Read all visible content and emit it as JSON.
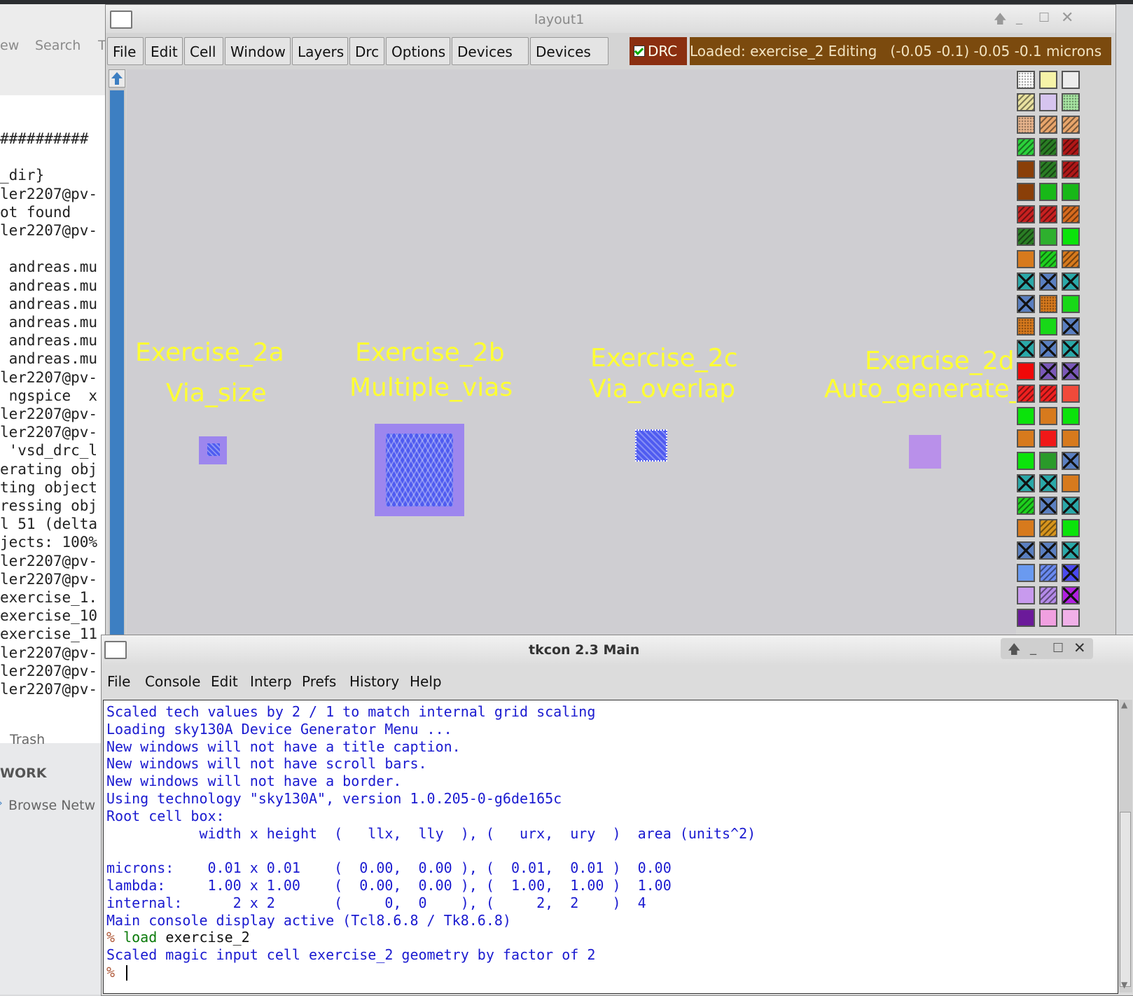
{
  "background_app": {
    "toolbar": {
      "menu_left": "ew",
      "search": "Search",
      "menu_right": "T"
    },
    "terminal_lines": [
      "##########",
      "",
      "_dir}",
      "ler2207@pv-",
      "ot found",
      "ler2207@pv-",
      "",
      " andreas.mu",
      " andreas.mu",
      " andreas.mu",
      " andreas.mu",
      " andreas.mu",
      " andreas.mu",
      "ler2207@pv-",
      " ngspice  x",
      "ler2207@pv-",
      "ler2207@pv-",
      " 'vsd_drc_l",
      "erating obj",
      "ting object",
      "ressing obj",
      "l 51 (delta",
      "jects: 100%",
      "ler2207@pv-",
      "ler2207@pv-",
      "exercise_1.",
      "exercise_10",
      "exercise_11",
      "ler2207@pv-",
      "ler2207@pv-",
      "ler2207@pv-"
    ],
    "sidebar": {
      "trash": "Trash",
      "network_header": "WORK",
      "browse": "Browse Netw"
    }
  },
  "layout_window": {
    "title": "layout1",
    "menu": [
      "File",
      "Edit",
      "Cell",
      "Window",
      "Layers",
      "Drc",
      "Options",
      "Devices 1",
      "Devices 2"
    ],
    "drc_label": "DRC",
    "status": "Loaded: exercise_2 Editing   (-0.05 -0.1) -0.05 -0.1 microns",
    "labels": {
      "ex2a_title": "Exercise_2a",
      "ex2a_sub": "Via_size",
      "ex2b_title": "Exercise_2b",
      "ex2b_sub": "Multiple_vias",
      "ex2c_title": "Exercise_2c",
      "ex2c_sub": "Via_overlap",
      "ex2d_title": "Exercise_2d",
      "ex2d_sub": "Auto_generate_v"
    },
    "colors": {
      "text": "#ffff33",
      "metal": "#9d86ee",
      "via": "#4f5bf0",
      "drc_bg": "#8b2f10",
      "status_bg": "#7b4a0e"
    }
  },
  "tkcon": {
    "title": "tkcon 2.3 Main",
    "menu": [
      "File",
      "Console",
      "Edit",
      "Interp",
      "Prefs",
      "History",
      "Help"
    ],
    "console_lines": [
      {
        "text": "Scaled tech values by 2 / 1 to match internal grid scaling",
        "color": "#1a1ad0"
      },
      {
        "text": "Loading sky130A Device Generator Menu ...",
        "color": "#1a1ad0"
      },
      {
        "text": "New windows will not have a title caption.",
        "color": "#1a1ad0"
      },
      {
        "text": "New windows will not have scroll bars.",
        "color": "#1a1ad0"
      },
      {
        "text": "New windows will not have a border.",
        "color": "#1a1ad0"
      },
      {
        "text": "Using technology \"sky130A\", version 1.0.205-0-g6de165c",
        "color": "#1a1ad0"
      },
      {
        "text": "Root cell box:",
        "color": "#1a1ad0"
      },
      {
        "text": "           width x height  (   llx,  lly  ), (   urx,  ury  )  area (units^2)",
        "color": "#1a1ad0"
      },
      {
        "text": "",
        "color": "#1a1ad0"
      },
      {
        "text": "microns:    0.01 x 0.01    (  0.00,  0.00 ), (  0.01,  0.01 )  0.00",
        "color": "#1a1ad0"
      },
      {
        "text": "lambda:     1.00 x 1.00    (  0.00,  0.00 ), (  1.00,  1.00 )  1.00",
        "color": "#1a1ad0"
      },
      {
        "text": "internal:      2 x 2       (     0,  0    ), (     2,  2    )  4",
        "color": "#1a1ad0"
      },
      {
        "text": "Main console display active (Tcl8.6.8 / Tk8.6.8)",
        "color": "#1a1ad0"
      }
    ],
    "prompt_symbol": "%",
    "command_keyword": "load",
    "command_arg": "exercise_2",
    "result_line": "Scaled magic input cell exercise_2 geometry by factor of 2"
  }
}
